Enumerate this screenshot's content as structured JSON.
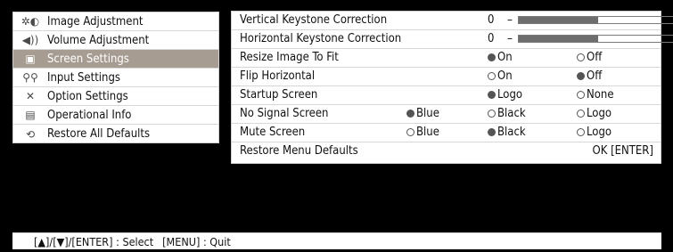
{
  "menu": {
    "items": [
      {
        "label": "Image Adjustment",
        "icon": "image-adjustment-icon",
        "selected": false
      },
      {
        "label": "Volume Adjustment",
        "icon": "volume-icon",
        "selected": false
      },
      {
        "label": "Screen Settings",
        "icon": "screen-settings-icon",
        "selected": true
      },
      {
        "label": "Input Settings",
        "icon": "input-settings-icon",
        "selected": false
      },
      {
        "label": "Option Settings",
        "icon": "option-settings-icon",
        "selected": false
      },
      {
        "label": "Operational Info",
        "icon": "operational-info-icon",
        "selected": false
      },
      {
        "label": "Restore All Defaults",
        "icon": "restore-defaults-icon",
        "selected": false
      }
    ]
  },
  "panel": {
    "vertical_keystone": {
      "label": "Vertical Keystone Correction",
      "value": "0",
      "minus": "–",
      "plus": "+",
      "level": 0.5
    },
    "horizontal_keystone": {
      "label": "Horizontal Keystone Correction",
      "value": "0",
      "minus": "–",
      "plus": "+",
      "level": 0.5
    },
    "resize_image": {
      "label": "Resize Image To Fit",
      "options": [
        "On",
        "Off"
      ],
      "selected": "On"
    },
    "flip_horizontal": {
      "label": "Flip Horizontal",
      "options": [
        "On",
        "Off"
      ],
      "selected": "Off"
    },
    "startup_screen": {
      "label": "Startup Screen",
      "options": [
        "Logo",
        "None"
      ],
      "selected": "Logo"
    },
    "no_signal_screen": {
      "label": "No Signal Screen",
      "options": [
        "Blue",
        "Black",
        "Logo"
      ],
      "selected": "Blue"
    },
    "mute_screen": {
      "label": "Mute Screen",
      "options": [
        "Blue",
        "Black",
        "Logo"
      ],
      "selected": "Black"
    },
    "restore_menu_defaults": {
      "label": "Restore Menu Defaults",
      "action": "OK [ENTER]"
    }
  },
  "help": {
    "select": "[▲]/[▼]/[ENTER] : Select",
    "quit": "[MENU] : Quit"
  },
  "colors": {
    "selected_bg": "#a79c91",
    "panel_bg": "#ffffff",
    "screen_bg": "#000000"
  }
}
